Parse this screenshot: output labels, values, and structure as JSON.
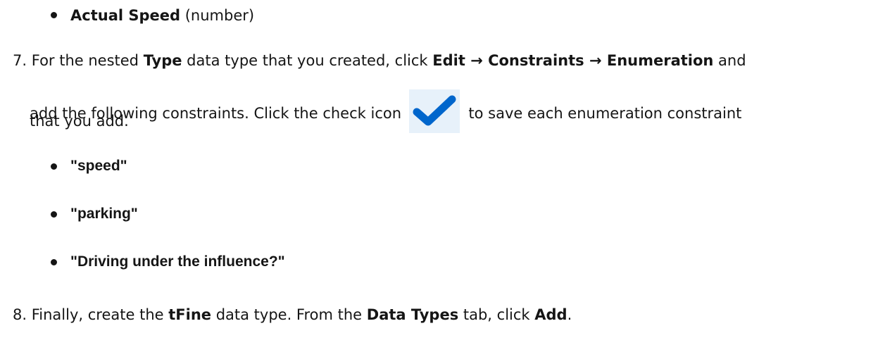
{
  "bullet_top": {
    "term": "Actual Speed",
    "suffix": " (number)"
  },
  "step7": {
    "number": "7.",
    "text1": "For the nested ",
    "term_type": "Type",
    "text2": " data type that you created, click ",
    "menu_path": "Edit → Constraints → Enumeration",
    "text3": " and",
    "text4": "add the following constraints. Click the check icon",
    "text5": " to save each enumeration constraint",
    "text6": "that you add.",
    "check_icon": "checkmark-icon",
    "constraints": [
      "\"speed\"",
      "\"parking\"",
      "\"Driving under the influence?\""
    ]
  },
  "step8": {
    "number": "8.",
    "text1": "Finally, create the ",
    "term_tfine": "tFine",
    "text2": " data type. From the ",
    "tab_name": "Data Types",
    "text3": " tab, click ",
    "add_label": "Add",
    "text4": "."
  },
  "colors": {
    "text": "#151515",
    "check_blue": "#0066cc",
    "check_bg": "#e7f1fa"
  }
}
